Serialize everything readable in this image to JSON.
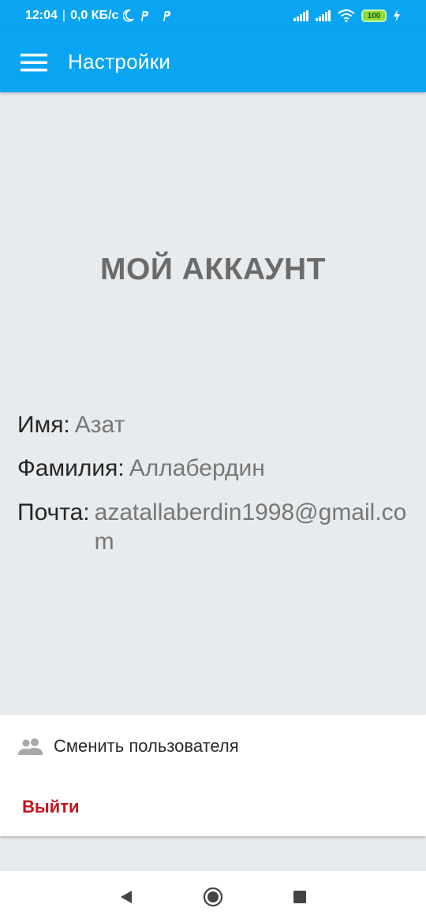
{
  "status_bar": {
    "time": "12:04",
    "separator": "|",
    "network_speed": "0,0 КБ/с",
    "battery_level": "100",
    "icons": [
      "moon-icon",
      "p-app-icon",
      "p-app-icon",
      "signal-icon",
      "signal-icon",
      "wifi-icon",
      "battery-icon",
      "charging-icon"
    ]
  },
  "app_bar": {
    "title": "Настройки",
    "menu_icon": "hamburger-menu-icon"
  },
  "account": {
    "title": "МОЙ АККАУНТ",
    "name_label": "Имя:",
    "name_value": "Азат",
    "surname_label": "Фамилия:",
    "surname_value": "Аллабердин",
    "email_label": "Почта:",
    "email_value": "azatallaberdin1998@gmail.com"
  },
  "actions": {
    "switch_user_label": "Сменить пользователя",
    "switch_user_icon": "people-icon",
    "logout_label": "Выйти"
  },
  "navigation": {
    "icons": [
      "back-triangle-icon",
      "home-circle-icon",
      "recents-square-icon"
    ]
  },
  "colors": {
    "primary": "#0aa5f2",
    "background": "#e8ebed",
    "logout": "#c8141b"
  }
}
